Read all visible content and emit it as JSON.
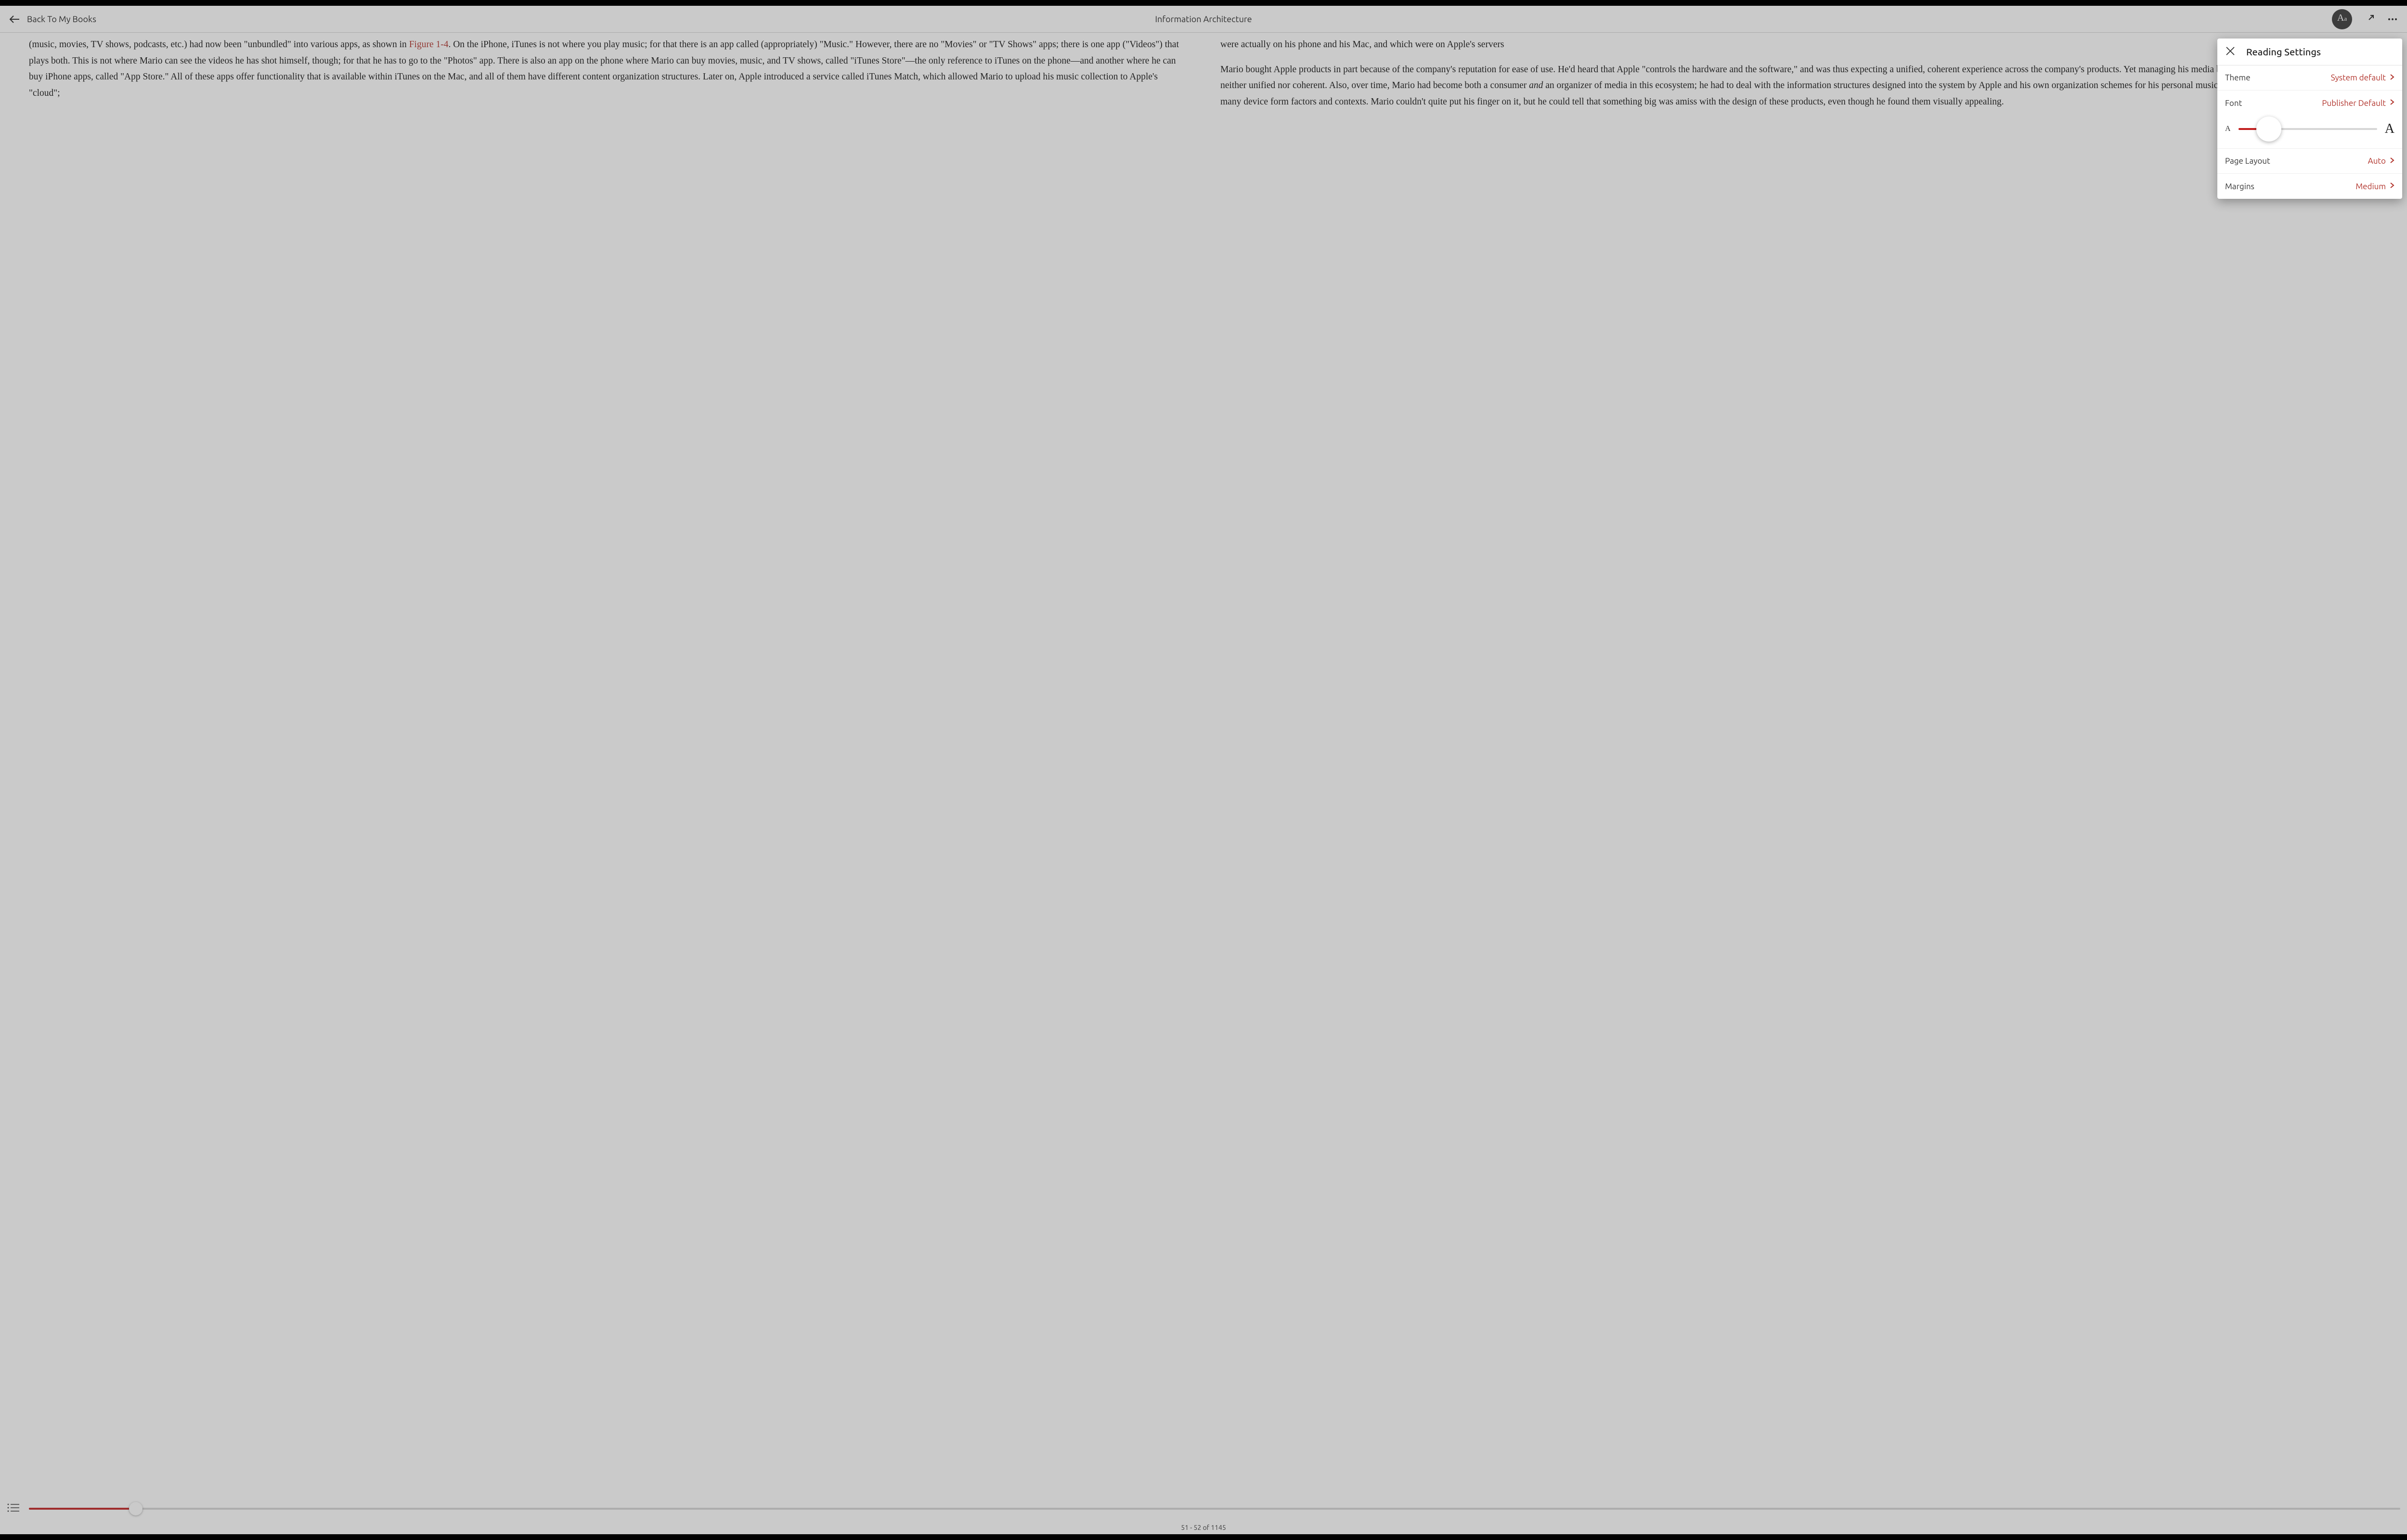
{
  "header": {
    "back_label": "Back To My Books",
    "title": "Information Architecture"
  },
  "content": {
    "left_top": "(music, movies, TV shows, podcasts, etc.) had now been \"unbundled\" into various apps, as shown in ",
    "fig_link": "Figure 1-4",
    "left_rest": ". On the iPhone, iTunes is not where you play music; for that there is an app called (appropriately) \"Music.\" However, there are no \"Movies\" or \"TV Shows\" apps; there is one app (\"Videos\") that plays both. This is not where Mario can see the videos he has shot himself, though; for that he has to go to the \"Photos\" app. There is also an app on the phone where Mario can buy movies, music, and TV shows, called \"iTunes Store\"—the only reference to iTunes on the phone—and another where he can buy iPhone apps, called \"App Store.\" All of these apps offer functionality that is available within iTunes on the Mac, and all of them have different content organization structures. Later on, Apple introduced a service called iTunes Match, which allowed Mario to upload his music collection to Apple's \"cloud\";",
    "right_top": "were actually on his phone and his Mac, and which were on Apple's servers",
    "right_para2_a": "Mario bought Apple products in part because of the company's reputation for ease of use. He'd heard that Apple \"controls the hardware and the software,\" and was thus expecting a unified, coherent experience across the company's products. Yet managing his media between his Mac and his iPhone was neither unified nor coherent. Also, over time, Mario had become both a consumer ",
    "right_para2_and": "and",
    "right_para2_b": " an organizer of media in this ecosystem; he had to deal with the information structures designed into the system by Apple and his own organization schemes for his personal music collection, which were now transcending many device form factors and contexts. Mario couldn't quite put his finger on it, but he could tell that something big was amiss with the design of these products, even though he found them visually appealing."
  },
  "footer": {
    "page_label": "51 - 52 of 1145",
    "progress_percent": 4.5
  },
  "popover": {
    "title": "Reading Settings",
    "rows": {
      "theme": {
        "label": "Theme",
        "value": "System default"
      },
      "font": {
        "label": "Font",
        "value": "Publisher Default",
        "slider_percent": 22
      },
      "page_layout": {
        "label": "Page Layout",
        "value": "Auto"
      },
      "margins": {
        "label": "Margins",
        "value": "Medium"
      }
    }
  }
}
